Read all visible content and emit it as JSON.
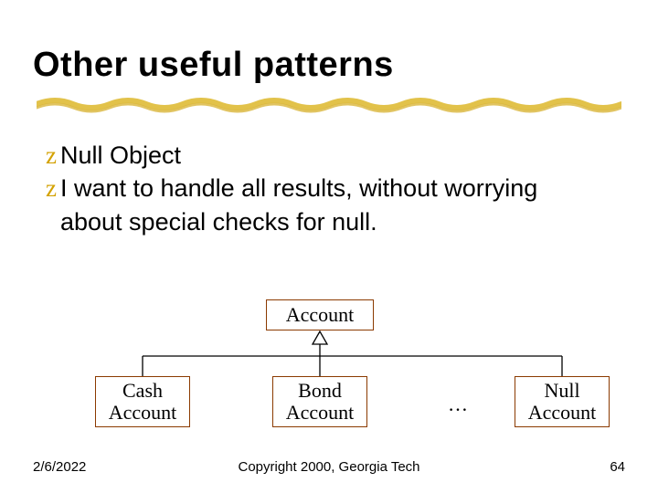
{
  "title": "Other useful patterns",
  "bullets": [
    "Null Object",
    "I want to handle all results, without worrying about special checks for null."
  ],
  "diagram": {
    "parent": "Account",
    "children": [
      "Cash\nAccount",
      "Bond\nAccount",
      "Null\nAccount"
    ],
    "ellipsis": "…"
  },
  "footer": {
    "date": "2/6/2022",
    "copyright": "Copyright 2000, Georgia Tech",
    "page": "64"
  },
  "glyph": "z"
}
